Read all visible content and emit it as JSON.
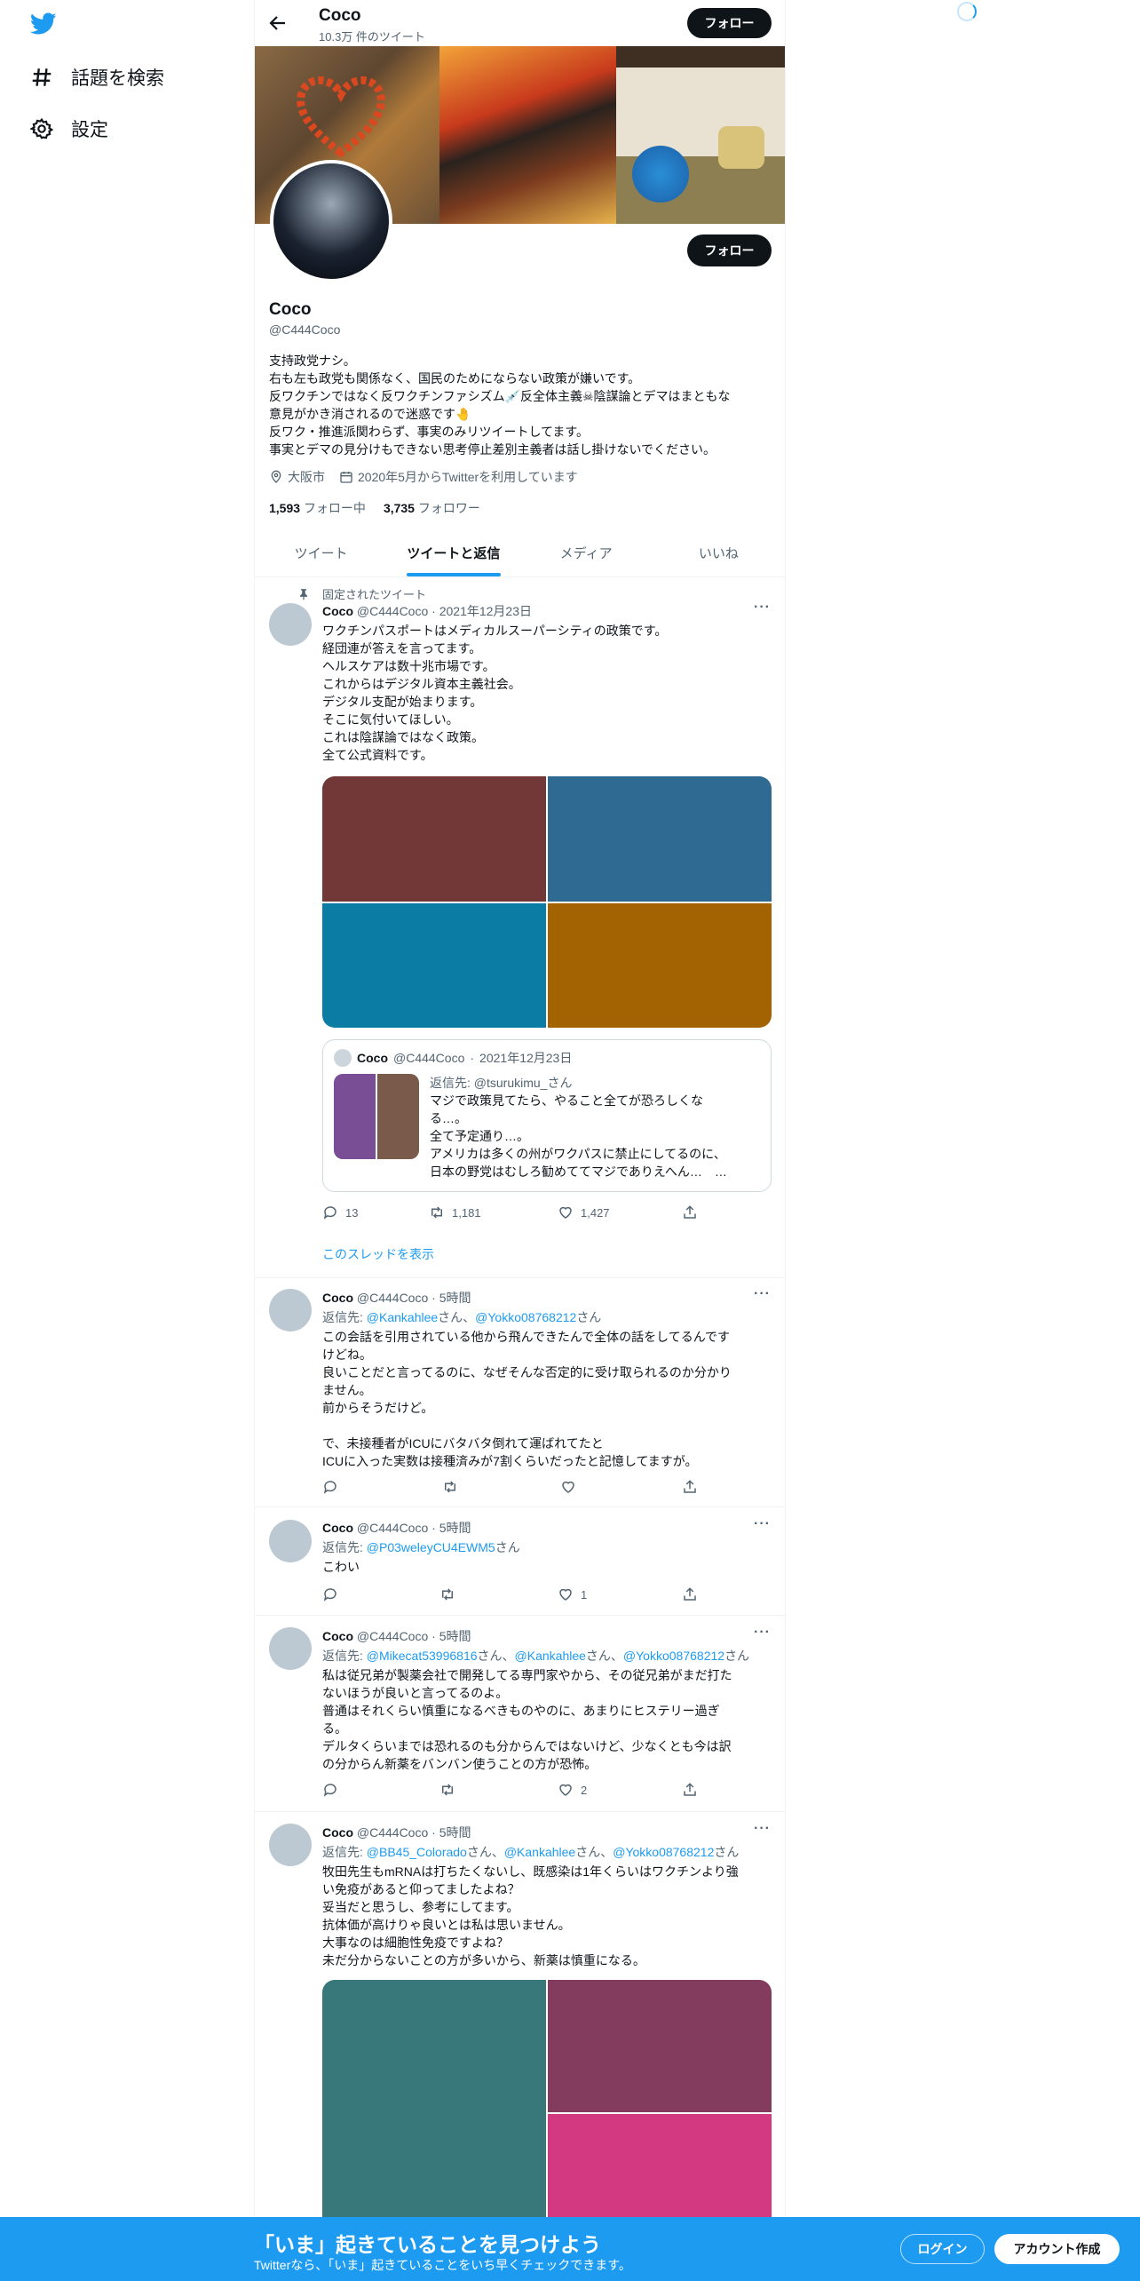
{
  "nav": {
    "items": [
      {
        "label": "話題を検索",
        "icon": "hashtag-icon"
      },
      {
        "label": "設定",
        "icon": "gear-icon"
      }
    ]
  },
  "header": {
    "title": "Coco",
    "subtitle": "10.3万 件のツイート",
    "follow_label": "フォロー"
  },
  "profile": {
    "follow_label": "フォロー",
    "name": "Coco",
    "handle": "@C444Coco",
    "bio_lines": [
      "支持政党ナシ。",
      "右も左も政党も関係なく、国民のためにならない政策が嫌いです。",
      "反ワクチンではなく反ワクチンファシズム💉反全体主義☠陰謀論とデマはまともな",
      "意見がかき消されるので迷惑です🤚",
      "反ワク・推進派関わらず、事実のみリツイートしてます。",
      "事実とデマの見分けもできない思考停止差別主義者は話し掛けないでください。"
    ],
    "location": "大阪市",
    "joined": "2020年5月からTwitterを利用しています",
    "following_count": "1,593",
    "following_label": "フォロー中",
    "followers_count": "3,735",
    "followers_label": "フォロワー"
  },
  "tabs": [
    "ツイート",
    "ツイートと返信",
    "メディア",
    "いいね"
  ],
  "active_tab": "ツイートと返信",
  "tweets": [
    {
      "pinned_label": "固定されたツイート",
      "name": "Coco",
      "handle": "@C444Coco",
      "time": "2021年12月23日",
      "lines": [
        "ワクチンパスポートはメディカルスーパーシティの政策です。",
        "経団連が答えを言ってます。",
        "ヘルスケアは数十兆市場です。",
        "これからはデジタル資本主義社会。",
        "デジタル支配が始まります。",
        "そこに気付いてほしい。",
        "これは陰謀論ではなく政策。",
        "全て公式資料です。"
      ],
      "media_colors": [
        "#723838",
        "#2f6a93",
        "#0b7ca3",
        "#a36302"
      ],
      "quote": {
        "name": "Coco",
        "handle": "@C444Coco",
        "time": "2021年12月23日",
        "reply_label": "返信先: @tsurukimu_さん",
        "lines": [
          "マジで政策見てたら、やること全てが恐ろしくな",
          "る…。",
          "全て予定通り…。",
          "アメリカは多くの州がワクパスに禁止にしてるのに、",
          "日本の野党はむしろ勧めててマジでありえへん…　…"
        ],
        "media_colors": [
          "#7a4e94",
          "#7a5a4a"
        ]
      },
      "replies": "13",
      "retweets": "1,181",
      "likes": "1,427",
      "thread_label": "このスレッドを表示"
    },
    {
      "name": "Coco",
      "handle": "@C444Coco",
      "time": "5時間",
      "reply_prefix": "返信先:",
      "reply_users": [
        "@Kankahlee",
        "@Yokko08768212"
      ],
      "lines": [
        "この会話を引用されている他から飛んできたんで全体の話をしてるんです",
        "けどね。",
        "良いことだと言ってるのに、なぜそんな否定的に受け取られるのか分かり",
        "ません。",
        "前からそうだけど。",
        "",
        "で、未接種者がICUにバタバタ倒れて運ばれてたと",
        "ICUに入った実数は接種済みが7割くらいだったと記憶してますが。"
      ],
      "replies": "",
      "retweets": "",
      "likes": ""
    },
    {
      "name": "Coco",
      "handle": "@C444Coco",
      "time": "5時間",
      "reply_prefix": "返信先:",
      "reply_users": [
        "@P03weleyCU4EWM5"
      ],
      "lines": [
        "こわい"
      ],
      "replies": "",
      "retweets": "",
      "likes": "1"
    },
    {
      "name": "Coco",
      "handle": "@C444Coco",
      "time": "5時間",
      "reply_prefix": "返信先:",
      "reply_users": [
        "@Mikecat53996816",
        "@Kankahlee",
        "@Yokko08768212"
      ],
      "lines": [
        "私は従兄弟が製薬会社で開発してる専門家やから、その従兄弟がまだ打た",
        "ないほうが良いと言ってるのよ。",
        "普通はそれくらい慎重になるべきものやのに、あまりにヒステリー過ぎ",
        "る。",
        "デルタくらいまでは恐れるのも分からんではないけど、少なくとも今は訳",
        "の分からん新薬をバンバン使うことの方が恐怖。"
      ],
      "replies": "",
      "retweets": "",
      "likes": "2"
    },
    {
      "name": "Coco",
      "handle": "@C444Coco",
      "time": "5時間",
      "reply_prefix": "返信先:",
      "reply_users": [
        "@BB45_Colorado",
        "@Kankahlee",
        "@Yokko08768212"
      ],
      "lines": [
        "牧田先生もmRNAは打ちたくないし、既感染は1年くらいはワクチンより強",
        "い免疫があると仰ってましたよね？",
        "妥当だと思うし、参考にしてます。",
        "抗体価が高けりゃ良いとは私は思いません。",
        "大事なのは細胞性免疫ですよね？",
        "未だ分からないことの方が多いから、新薬は慎重になる。"
      ],
      "media_colors": [
        "#38787a",
        "#843c5e",
        "#d33981"
      ]
    }
  ],
  "san": "さん",
  "bottom": {
    "title": "「いま」起きていることを見つけよう",
    "subtitle": "Twitterなら、「いま」起きていることをいち早くチェックできます。",
    "login_label": "ログイン",
    "signup_label": "アカウント作成"
  }
}
